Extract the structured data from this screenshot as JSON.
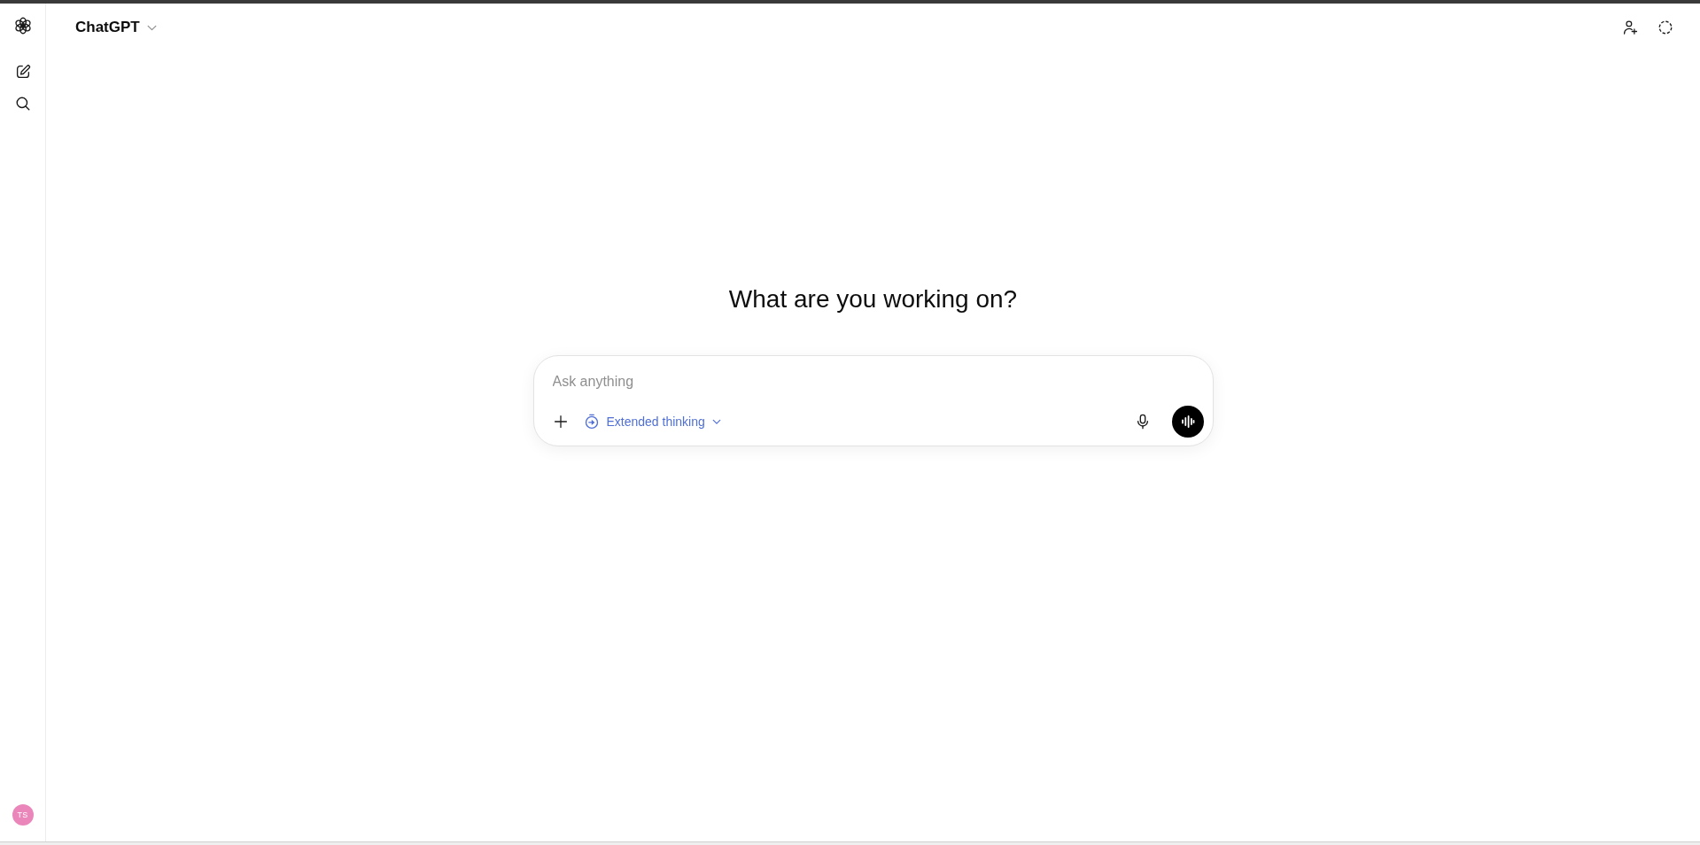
{
  "sidebar": {
    "avatar": {
      "initials": "TS"
    }
  },
  "header": {
    "title": "ChatGPT"
  },
  "main": {
    "heading": "What are you working on?"
  },
  "composer": {
    "placeholder": "Ask anything",
    "mode": {
      "label": "Extended thinking"
    }
  }
}
